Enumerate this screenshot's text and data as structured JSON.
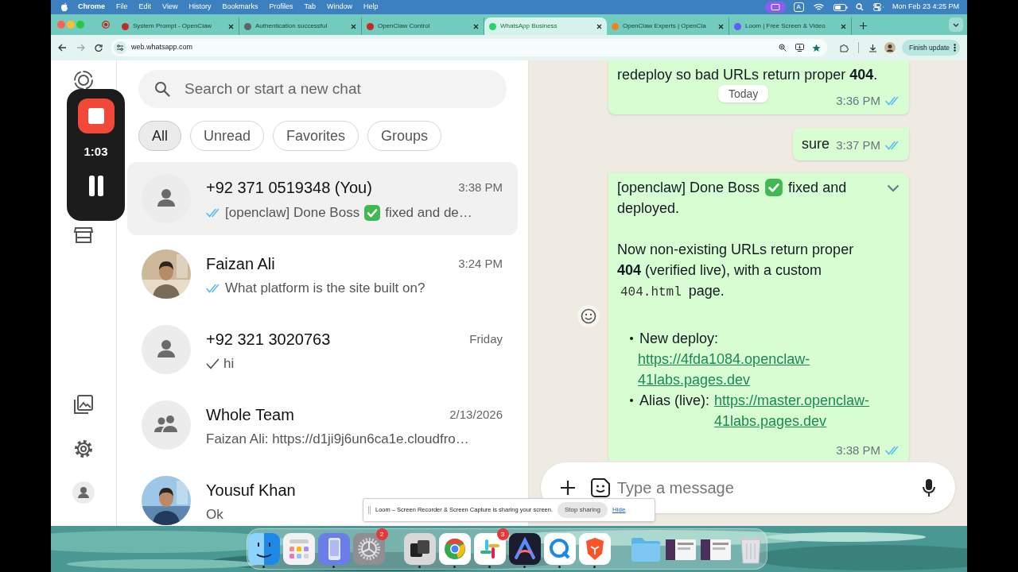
{
  "menu_bar": {
    "app": "Chrome",
    "menus": [
      "File",
      "Edit",
      "View",
      "History",
      "Bookmarks",
      "Profiles",
      "Tab",
      "Window",
      "Help"
    ],
    "input_source": "A",
    "clock": "Mon Feb 23 4:25 PM"
  },
  "browser": {
    "tabs": [
      {
        "title": "System Prompt - OpenClaw",
        "color": "#c62828",
        "selected": false
      },
      {
        "title": "Authentication successful",
        "color": "#5f6368",
        "selected": false
      },
      {
        "title": "OpenClaw Control",
        "color": "#c62828",
        "selected": false
      },
      {
        "title": "WhatsApp Business",
        "color": "#25d366",
        "selected": true
      },
      {
        "title": "OpenClaw Experts | OpenCla",
        "color": "#f48120",
        "selected": false
      },
      {
        "title": "Loom | Free Screen & Video",
        "color": "#625df5",
        "selected": false
      }
    ],
    "url": "web.whatsapp.com",
    "update_button": "Finish update"
  },
  "recorder": {
    "timer": "1:03"
  },
  "chat_list": {
    "search_placeholder": "Search or start a new chat",
    "filters": [
      {
        "label": "All",
        "selected": true
      },
      {
        "label": "Unread",
        "selected": false
      },
      {
        "label": "Favorites",
        "selected": false
      },
      {
        "label": "Groups",
        "selected": false
      }
    ],
    "chats": [
      {
        "kind": "person",
        "name": "+92 371 0519348 (You)",
        "time": "3:38 PM",
        "read": true,
        "preview": [
          {
            "kind": "text",
            "text": "[openclaw] Done Boss"
          },
          {
            "kind": "check_emoji"
          },
          {
            "kind": "text",
            "text": "fixed and de…"
          }
        ],
        "selected": true
      },
      {
        "kind": "picture",
        "name": "Faizan Ali",
        "time": "3:24 PM",
        "read": true,
        "preview": [
          {
            "kind": "text",
            "text": "What platform is the site built on?"
          }
        ],
        "selected": false
      },
      {
        "kind": "person",
        "name": "+92 321 3020763",
        "time": "Friday",
        "read": false,
        "preview": [
          {
            "kind": "text",
            "text": "hi"
          }
        ],
        "selected": false
      },
      {
        "kind": "group",
        "name": "Whole Team",
        "time": "2/13/2026",
        "preview": [
          {
            "kind": "text",
            "text": "Faizan Ali: https://d1ji9j6un6ca1e.cloudfro…"
          }
        ],
        "selected": false
      },
      {
        "kind": "picture",
        "name": "Yousuf Khan",
        "preview": [
          {
            "kind": "text",
            "text": "Ok"
          }
        ],
        "selected": false
      }
    ]
  },
  "conversation": {
    "date_divider": "Today",
    "messages": [
      {
        "kind": "plain",
        "text": "redeploy so bad URLs return proper **404**.",
        "time": "3:36 PM",
        "read": true
      },
      {
        "kind": "short",
        "text": "sure",
        "time": "3:37 PM",
        "read": true
      },
      {
        "kind": "rich",
        "time": "3:38 PM",
        "read": true,
        "blocks": [
          {
            "kind": "emoji_line",
            "parts": [
              {
                "kind": "text",
                "text": "[openclaw] Done Boss"
              },
              {
                "kind": "check_emoji"
              },
              {
                "kind": "text",
                "text": "fixed and"
              }
            ],
            "continued": "deployed."
          },
          {
            "kind": "para",
            "text": "Now non-existing URLs return proper **404** (verified live), with a custom",
            "code": "404.html",
            "after": "page."
          },
          {
            "kind": "bullet",
            "label": "New deploy:",
            "link": "https://4fda1084.openclaw-41labs.pages.dev",
            "link_below": true
          },
          {
            "kind": "bullet",
            "label": "Alias (live):",
            "link": "https://master.openclaw-41labs.pages.dev",
            "link_below": false
          }
        ]
      }
    ]
  },
  "composer": {
    "placeholder": "Type a message"
  },
  "share_notice": {
    "text": "Loom – Screen Recorder & Screen Capture is sharing your screen.",
    "stop_button": "Stop sharing",
    "hide_link": "Hide"
  },
  "dock": {
    "groups": [
      {
        "items": [
          {
            "kind": "finder",
            "running": true
          },
          {
            "kind": "launchpad",
            "running": false
          },
          {
            "kind": "phone",
            "running": true
          },
          {
            "kind": "settings",
            "running": false,
            "badge": "2"
          }
        ]
      },
      {
        "items": [
          {
            "kind": "stacked",
            "running": true
          },
          {
            "kind": "chrome",
            "running": true
          },
          {
            "kind": "slack",
            "running": true,
            "badge": "3"
          },
          {
            "kind": "arc",
            "running": true
          },
          {
            "kind": "q",
            "running": true
          },
          {
            "kind": "brave",
            "running": true
          }
        ]
      },
      {
        "items": [
          {
            "kind": "folder",
            "running": false
          },
          {
            "kind": "window",
            "running": false
          },
          {
            "kind": "window",
            "running": false
          },
          {
            "kind": "trash",
            "running": false
          }
        ]
      }
    ]
  }
}
